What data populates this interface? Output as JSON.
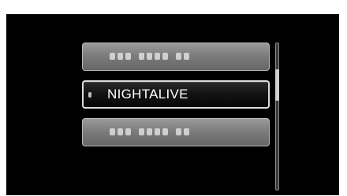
{
  "menu": {
    "items": [
      {
        "label": "",
        "state": "blurred"
      },
      {
        "label": "NIGHTALIVE",
        "state": "selected"
      },
      {
        "label": "",
        "state": "blurred"
      }
    ]
  },
  "colors": {
    "background": "#000000",
    "item_dim": "#7d7d7d",
    "item_selected": "#121212",
    "selected_border": "#dcdcdc",
    "text": "#ffffff"
  },
  "icons": {
    "selection_marker": "bullet-icon"
  }
}
